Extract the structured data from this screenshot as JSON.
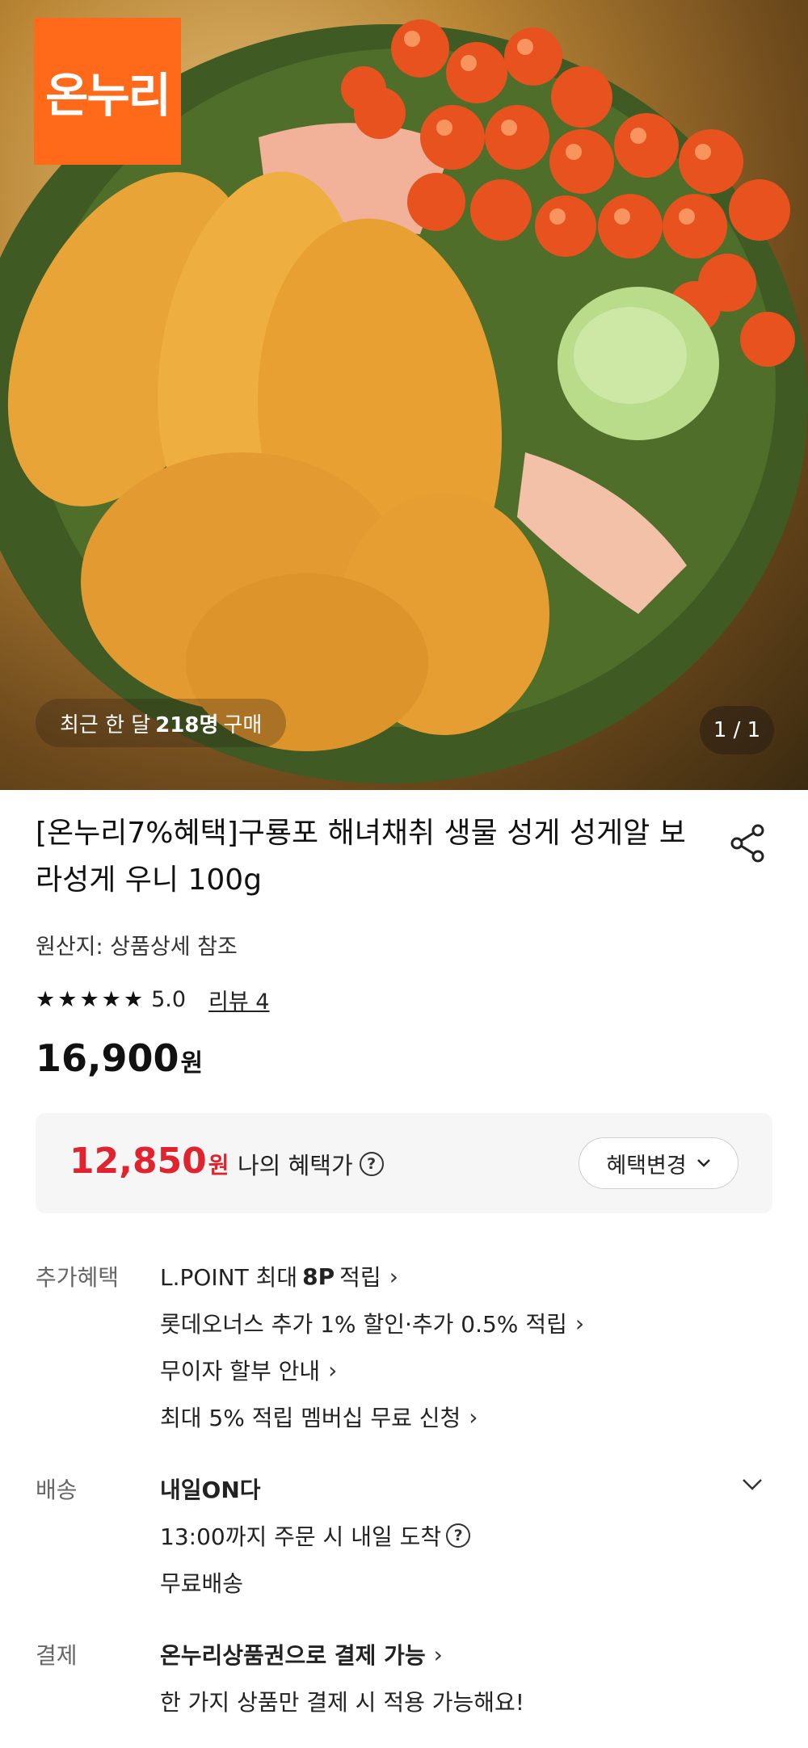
{
  "hero": {
    "logo_text": "온누리",
    "buyers_prefix": "최근 한 달",
    "buyers_count": "218명",
    "buyers_suffix": "구매",
    "pager": "1 / 1"
  },
  "product": {
    "title": "[온누리7%혜택]구룡포 해녀채취 생물 성게 성게알 보라성게 우니 100g",
    "origin": "원산지: 상품상세 참조",
    "rating_stars": 5,
    "rating": "5.0",
    "review_link": "리뷰 4",
    "price": "16,900",
    "currency": "원"
  },
  "benefit": {
    "price": "12,850",
    "currency": "원",
    "label": "나의 혜택가",
    "change_button": "혜택변경"
  },
  "extra": {
    "label": "추가혜택",
    "lpoint_pre": "L.POINT 최대",
    "lpoint_bold": "8P",
    "lpoint_post": "적립",
    "item2": "롯데오너스 추가 1% 할인·추가 0.5% 적립",
    "item3": "무이자 할부 안내",
    "item4": "최대 5% 적립 멤버십 무료 신청"
  },
  "delivery": {
    "label": "배송",
    "title": "내일ON다",
    "line1": "13:00까지 주문 시 내일 도착",
    "line2": "무료배송"
  },
  "payment": {
    "label": "결제",
    "title": "온누리상품권으로 결제 가능",
    "line1": "한 가지 상품만 결제 시 적용 가능해요!"
  },
  "colors": {
    "logo_bg": "#ff6a1a",
    "benefit_price": "#e0242f"
  },
  "icons": [
    "share-icon",
    "question-icon",
    "chevron-right-icon",
    "chevron-down-icon",
    "star-icon"
  ]
}
